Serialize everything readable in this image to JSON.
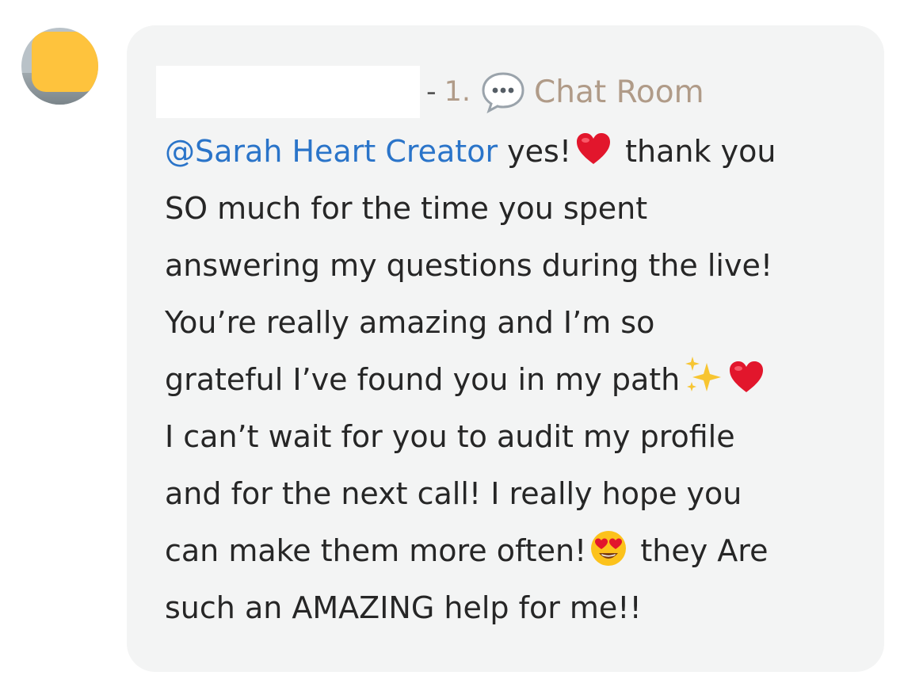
{
  "post": {
    "author_name": "",
    "separator": "-",
    "room_number": "1.",
    "room_icon": "speech-bubble-icon",
    "room_name": "Chat Room"
  },
  "message": {
    "mention": "@Sarah Heart Creator",
    "line1_after_mention": " yes!",
    "line1_after_heart": " thank you",
    "line2": "SO much for the time you spent",
    "line3": "answering my questions during the live!",
    "line4": "You’re really amazing and I’m so",
    "line5": "grateful I’ve found you in my path",
    "line6": "I can’t wait for you to audit my profile",
    "line7": "and for the next call! I really hope you",
    "line8_before_emoji": "can make them more often!",
    "line8_after_emoji": " they Are",
    "line9": "such an AMAZING help for me!!"
  },
  "colors": {
    "bubble": "#f3f4f4",
    "mention": "#2a74c9",
    "room_link": "#b09b88",
    "text": "#262626",
    "avatar_cover": "#fec33d"
  }
}
